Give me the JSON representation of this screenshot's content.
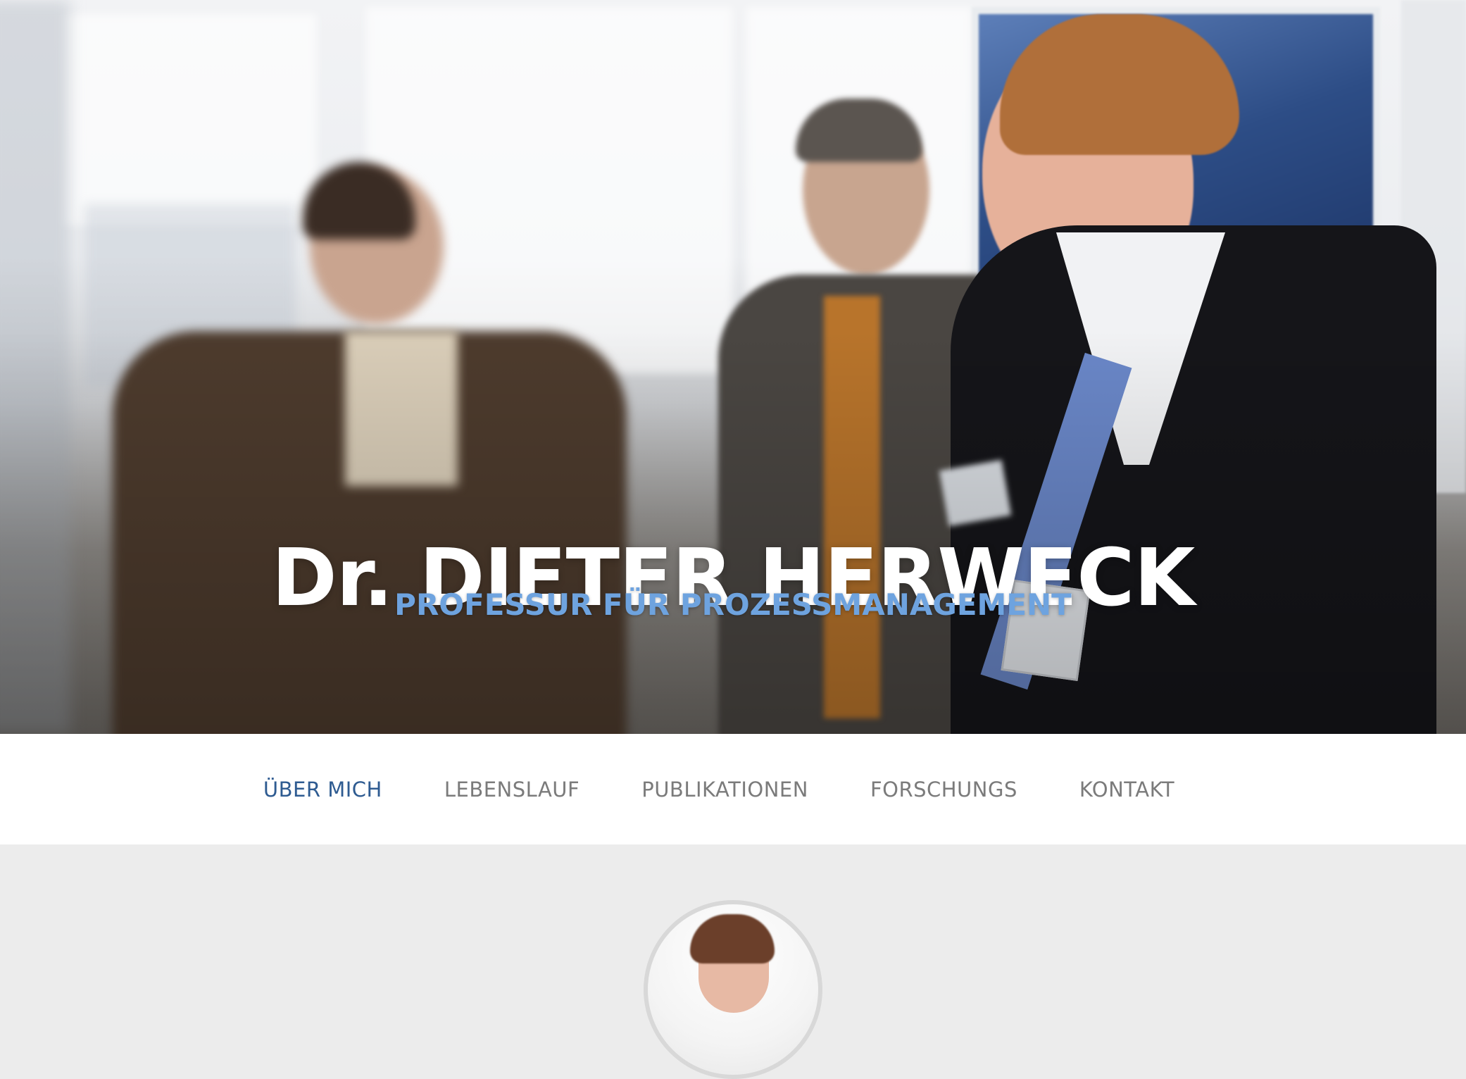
{
  "hero": {
    "title": "Dr. DIETER HERWECK",
    "subtitle": "PROFESSUR FÜR PROZESSMANAGEMENT",
    "subtitle_color": "#6ea3df",
    "title_color": "#ffffff"
  },
  "nav": {
    "items": [
      {
        "label": "ÜBER MICH",
        "active": true
      },
      {
        "label": "LEBENSLAUF",
        "active": false
      },
      {
        "label": "PUBLIKATIONEN",
        "active": false
      },
      {
        "label": "FORSCHUNGS",
        "active": false
      },
      {
        "label": "KONTAKT",
        "active": false
      }
    ],
    "active_color": "#2e5b91",
    "inactive_color": "#7b7b7b"
  },
  "colors": {
    "page_background": "#ececec",
    "navbar_background": "#ffffff"
  }
}
